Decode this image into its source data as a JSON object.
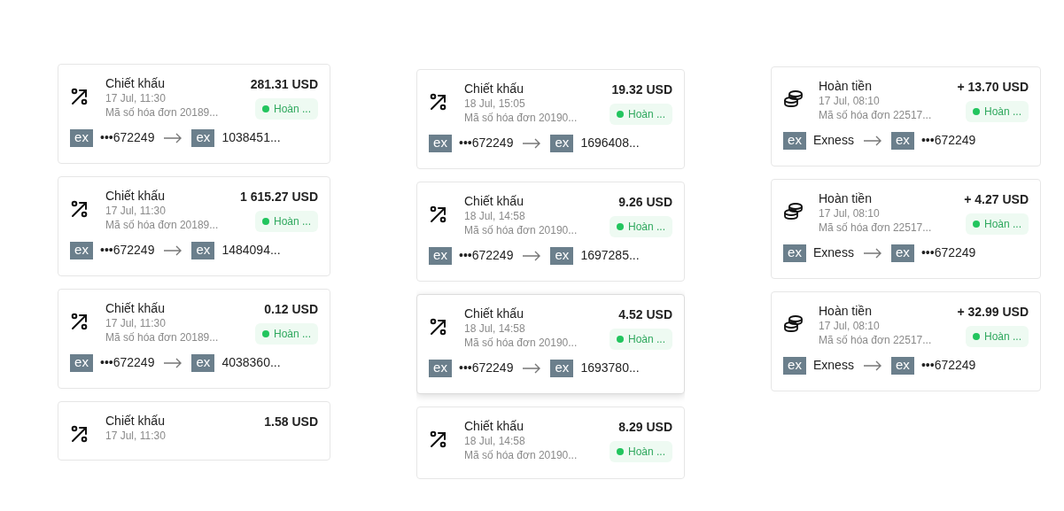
{
  "columns": [
    {
      "cards": [
        {
          "kind": "discount",
          "selected": false,
          "title": "Chiết khấu",
          "date": "17 Jul, 11:30",
          "invoice": "Mã số hóa đơn 20189...",
          "amount": "281.31 USD",
          "status": "Hoàn ...",
          "from_logo": "ex",
          "from": "•••672249",
          "to_logo": "ex",
          "to": "1038451..."
        },
        {
          "kind": "discount",
          "selected": false,
          "title": "Chiết khấu",
          "date": "17 Jul, 11:30",
          "invoice": "Mã số hóa đơn 20189...",
          "amount": "1 615.27 USD",
          "status": "Hoàn ...",
          "from_logo": "ex",
          "from": "•••672249",
          "to_logo": "ex",
          "to": "1484094..."
        },
        {
          "kind": "discount",
          "selected": false,
          "title": "Chiết khấu",
          "date": "17 Jul, 11:30",
          "invoice": "Mã số hóa đơn 20189...",
          "amount": "0.12 USD",
          "status": "Hoàn ...",
          "from_logo": "ex",
          "from": "•••672249",
          "to_logo": "ex",
          "to": "4038360..."
        },
        {
          "kind": "discount",
          "selected": false,
          "title": "Chiết khấu",
          "date": "17 Jul, 11:30",
          "amount": "1.58 USD"
        }
      ]
    },
    {
      "cards": [
        {
          "kind": "discount",
          "selected": false,
          "title": "Chiết khấu",
          "date": "18 Jul, 15:05",
          "invoice": "Mã số hóa đơn 20190...",
          "amount": "19.32 USD",
          "status": "Hoàn ...",
          "from_logo": "ex",
          "from": "•••672249",
          "to_logo": "ex",
          "to": "1696408..."
        },
        {
          "kind": "discount",
          "selected": false,
          "title": "Chiết khấu",
          "date": "18 Jul, 14:58",
          "invoice": "Mã số hóa đơn 20190...",
          "amount": "9.26 USD",
          "status": "Hoàn ...",
          "from_logo": "ex",
          "from": "•••672249",
          "to_logo": "ex",
          "to": "1697285..."
        },
        {
          "kind": "discount",
          "selected": true,
          "title": "Chiết khấu",
          "date": "18 Jul, 14:58",
          "invoice": "Mã số hóa đơn 20190...",
          "amount": "4.52 USD",
          "status": "Hoàn ...",
          "from_logo": "ex",
          "from": "•••672249",
          "to_logo": "ex",
          "to": "1693780..."
        },
        {
          "kind": "discount",
          "selected": false,
          "title": "Chiết khấu",
          "date": "18 Jul, 14:58",
          "invoice": "Mã số hóa đơn 20190...",
          "amount": "8.29 USD",
          "status": "Hoàn ..."
        }
      ]
    },
    {
      "cards": [
        {
          "kind": "refund",
          "selected": false,
          "title": "Hoàn tiền",
          "date": "17 Jul, 08:10",
          "invoice": "Mã số hóa đơn 22517...",
          "amount": "+ 13.70 USD",
          "status": "Hoàn ...",
          "from_logo": "ex",
          "from": "Exness",
          "to_logo": "ex",
          "to": "•••672249"
        },
        {
          "kind": "refund",
          "selected": false,
          "title": "Hoàn tiền",
          "date": "17 Jul, 08:10",
          "invoice": "Mã số hóa đơn 22517...",
          "amount": "+ 4.27 USD",
          "status": "Hoàn ...",
          "from_logo": "ex",
          "from": "Exness",
          "to_logo": "ex",
          "to": "•••672249"
        },
        {
          "kind": "refund",
          "selected": false,
          "title": "Hoàn tiền",
          "date": "17 Jul, 08:10",
          "invoice": "Mã số hóa đơn 22517...",
          "amount": "+ 32.99 USD",
          "status": "Hoàn ...",
          "from_logo": "ex",
          "from": "Exness",
          "to_logo": "ex",
          "to": "•••672249"
        }
      ]
    }
  ]
}
